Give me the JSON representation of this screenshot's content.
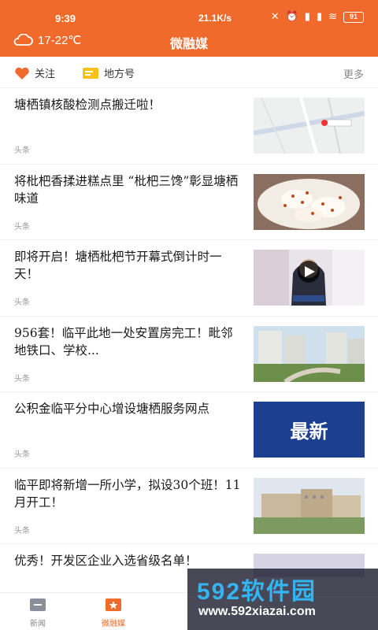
{
  "status_bar": {
    "time": "9:39",
    "network_speed": "21.1K/s",
    "battery": "91"
  },
  "header": {
    "temperature": "17-22℃",
    "title": "微融媒",
    "weather_icon": "cloud-icon",
    "background_color": "#f06a2b"
  },
  "subnav": {
    "items": [
      {
        "label": "关注",
        "icon": "heart-icon"
      },
      {
        "label": "地方号",
        "icon": "card-icon"
      }
    ],
    "more_label": "更多"
  },
  "feed": [
    {
      "title": "塘栖镇核酸检测点搬迁啦！",
      "tag": "头条",
      "thumb": "map-thumbnail"
    },
    {
      "title": "将枇杷香揉进糕点里  “枇杷三馋”彰显塘栖味道",
      "tag": "头条",
      "thumb": "food-thumbnail"
    },
    {
      "title": "即将开启！塘栖枇杷节开幕式倒计时一天！",
      "tag": "头条",
      "thumb": "video-thumbnail"
    },
    {
      "title": "956套！临平此地一处安置房完工！毗邻地铁口、学校...",
      "tag": "头条",
      "thumb": "buildings-thumbnail"
    },
    {
      "title": "公积金临平分中心增设塘栖服务网点",
      "tag": "头条",
      "thumb": "latest-banner",
      "thumb_text": "最新"
    },
    {
      "title": "临平即将新增一所小学，拟设30个班！11月开工！",
      "tag": "头条",
      "thumb": "school-thumbnail"
    },
    {
      "title": "优秀！开发区企业入选省级名单！",
      "tag": "",
      "thumb": "poster-thumbnail"
    }
  ],
  "bottom_tabs": [
    {
      "label": "新闻",
      "icon": "news-icon",
      "active": false
    },
    {
      "label": "微融媒",
      "icon": "media-icon",
      "active": true
    }
  ],
  "watermark": {
    "brand": "592软件园",
    "url": "www.592xiazai.com"
  }
}
